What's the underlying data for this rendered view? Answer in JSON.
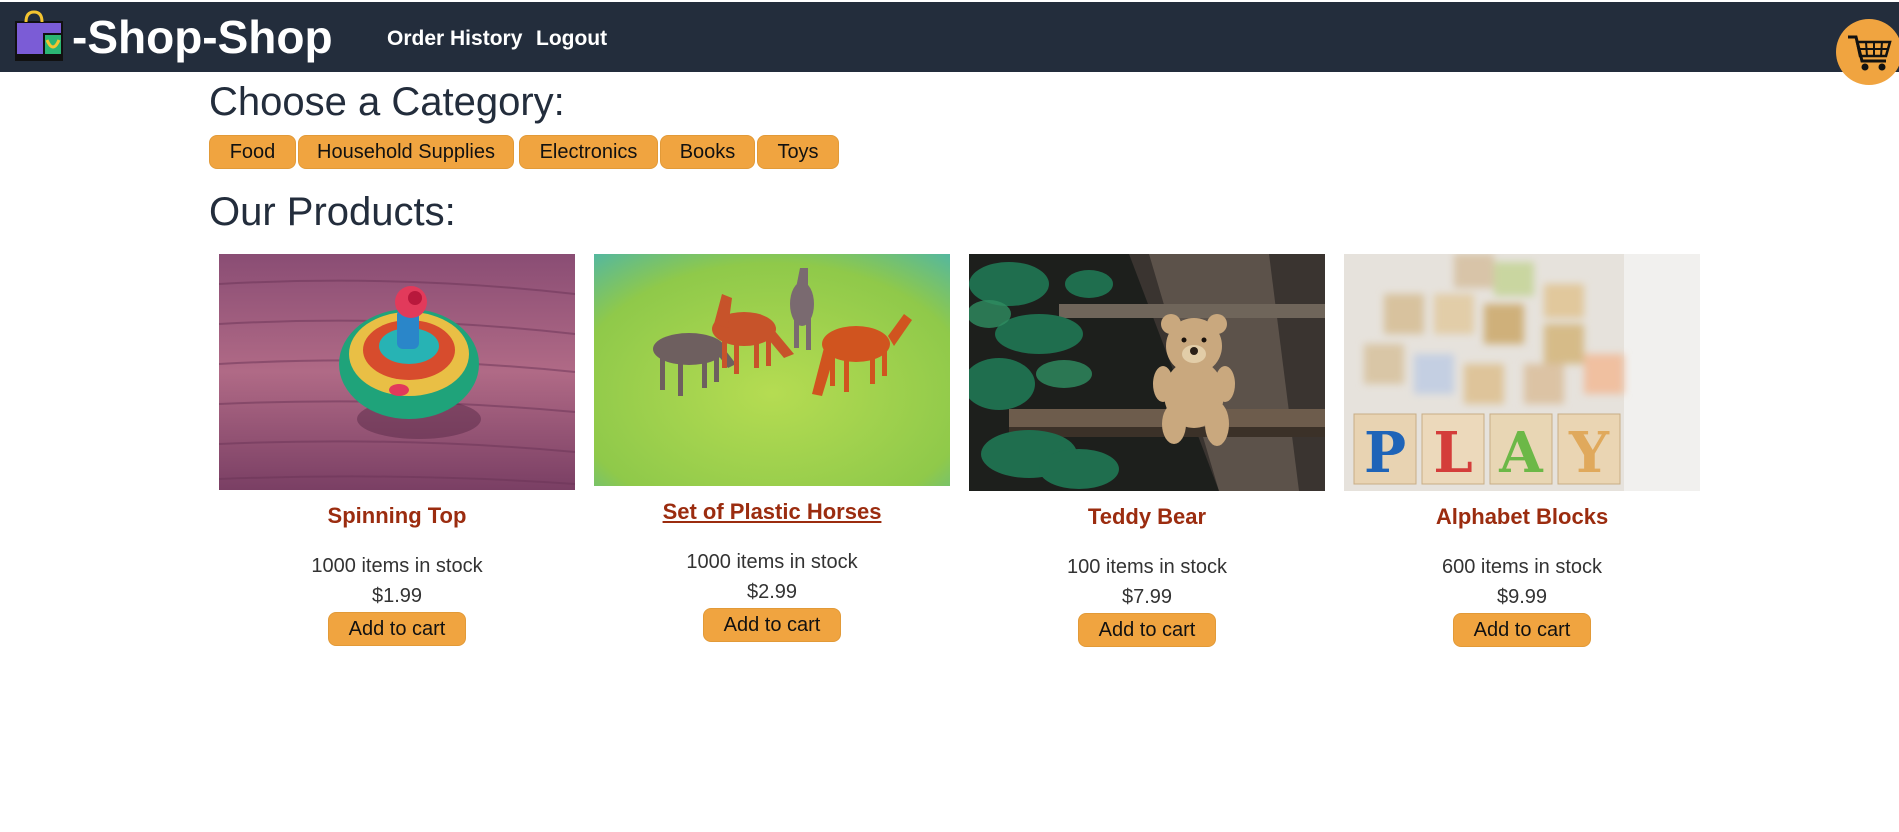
{
  "nav": {
    "brand": "-Shop-Shop",
    "links": [
      "Order History",
      "Logout"
    ],
    "logo_icon": "shopping-bag-icon",
    "cart_icon": "cart-icon"
  },
  "categories": {
    "heading": "Choose a Category:",
    "items": [
      "Food",
      "Household Supplies",
      "Electronics",
      "Books",
      "Toys"
    ]
  },
  "products": {
    "heading": "Our Products:",
    "items": [
      {
        "name": "Spinning Top",
        "stock": "1000 items in stock",
        "price": "$1.99",
        "button": "Add to cart",
        "image": "spinning-top-photo"
      },
      {
        "name": "Set of Plastic Horses",
        "stock": "1000 items in stock",
        "price": "$2.99",
        "button": "Add to cart",
        "image": "plastic-horses-photo"
      },
      {
        "name": "Teddy Bear",
        "stock": "100 items in stock",
        "price": "$7.99",
        "button": "Add to cart",
        "image": "teddy-bear-photo"
      },
      {
        "name": "Alphabet Blocks",
        "stock": "600 items in stock",
        "price": "$9.99",
        "button": "Add to cart",
        "image": "alphabet-blocks-photo"
      }
    ]
  },
  "colors": {
    "navbar": "#232d3c",
    "accent": "#f0a440",
    "product_name": "#9b2c0f"
  }
}
